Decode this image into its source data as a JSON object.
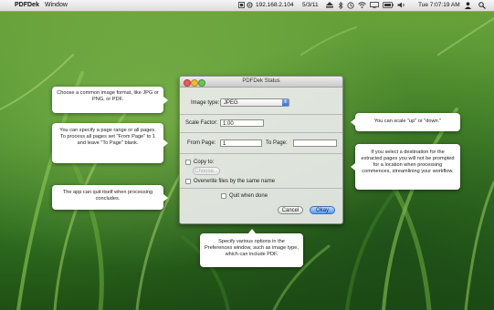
{
  "menubar": {
    "apple_glyph": "",
    "app_name": "PDFDek",
    "menu_window": "Window",
    "ip": "192.168.2.104",
    "date": "5/3/11",
    "clock": "Tue 7:07:19 AM"
  },
  "window": {
    "title": "PDFDek Status",
    "image_type_label": "Image type:",
    "image_type_value": "JPEG",
    "scale_factor_label": "Scale Factor:",
    "scale_factor_value": "1.00",
    "from_page_label": "From Page:",
    "from_page_value": "1",
    "to_page_label": "To Page:",
    "to_page_value": "",
    "copy_to_label": "Copy to:",
    "choose_button": "Choose...",
    "overwrite_label": "Overwrite files by the same name",
    "quit_label": "Quit when done",
    "cancel_button": "Cancel",
    "okay_button": "Okay"
  },
  "callouts": {
    "image_format": "Choose a common image format, like JPG or PNG, or PDF.",
    "page_range": "You can specify a page range or all pages. To process all pages set \"From Page\" to 1 and leave \"To Page\" blank.",
    "quit": "The app can quit itself when processing concludes.",
    "scale": "You can scale \"up\" or \"down.\"",
    "destination": "If you select a destination for the extracted pages you will not be prompted for a location when processing commences, streamlining your workflow.",
    "preferences": "Specify various options in the Preferences window, such as image type, which can include PDF."
  },
  "colors": {
    "wallpaper": "#4d8f2d",
    "primary_button": "#5a9af2"
  }
}
